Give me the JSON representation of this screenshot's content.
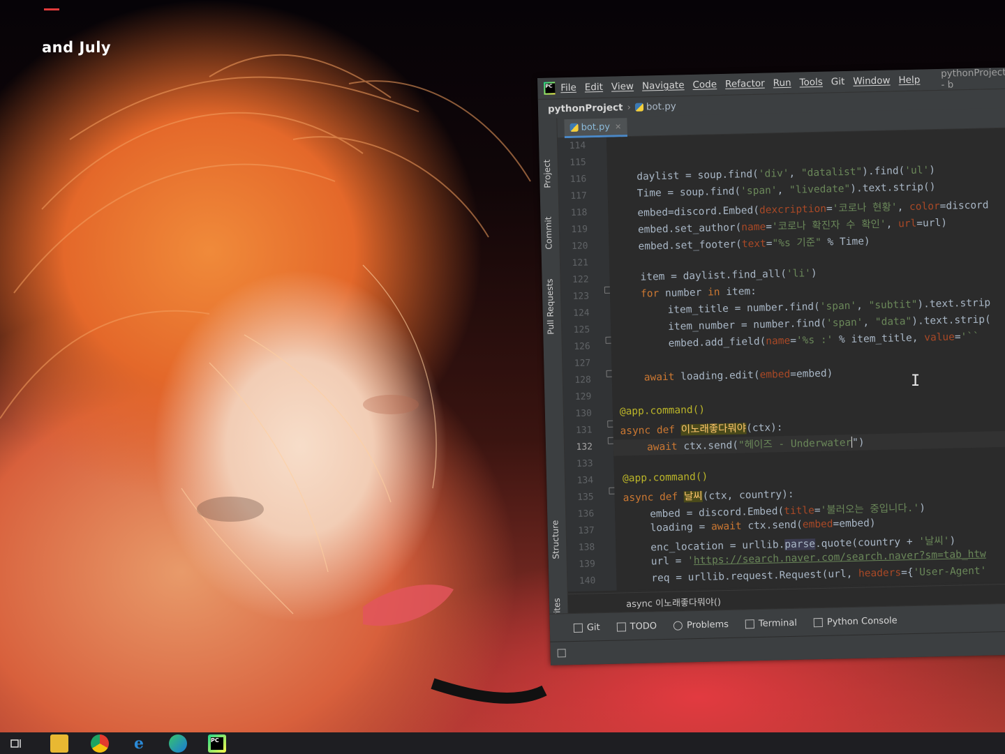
{
  "wallpaper": {
    "caption": "and July"
  },
  "ide": {
    "menu": [
      "File",
      "Edit",
      "View",
      "Navigate",
      "Code",
      "Refactor",
      "Run",
      "Tools",
      "Git",
      "Window",
      "Help"
    ],
    "window_title": "pythonProject - b",
    "breadcrumb": {
      "project": "pythonProject",
      "file": "bot.py"
    },
    "tab": {
      "label": "bot.py"
    },
    "side_tabs": [
      "Project",
      "Commit",
      "Pull Requests",
      "Structure",
      "Favorites"
    ],
    "line_numbers": [
      "114",
      "115",
      "116",
      "117",
      "118",
      "119",
      "120",
      "121",
      "122",
      "123",
      "124",
      "125",
      "126",
      "127",
      "128",
      "129",
      "130",
      "131",
      "132",
      "133",
      "134",
      "135",
      "136",
      "137",
      "138",
      "139",
      "140"
    ],
    "current_line": "132",
    "code": {
      "l116": [
        "daylist = soup.find(",
        "'div'",
        ", ",
        "\"datalist\"",
        ").find(",
        "'ul'",
        ")"
      ],
      "l117": [
        "Time = soup.find(",
        "'span'",
        ", ",
        "\"livedate\"",
        ").text.strip()"
      ],
      "l118": [
        "embed=discord.Embed(",
        "dexcription",
        "=",
        "'코로나 현황'",
        ", ",
        "color",
        "=discord"
      ],
      "l119": [
        "embed.set_author(",
        "name",
        "=",
        "'코로나 확진자 수 확인'",
        ", ",
        "url",
        "=url)"
      ],
      "l120": [
        "embed.set_footer(",
        "text",
        "=",
        "\"%s 기준\"",
        " % Time)"
      ],
      "l122": [
        "item = daylist.find_all(",
        "'li'",
        ")"
      ],
      "l123": [
        "for",
        " number ",
        "in",
        " item:"
      ],
      "l124": [
        "item_title = number.find(",
        "'span'",
        ", ",
        "\"subtit\"",
        ").text.strip"
      ],
      "l125": [
        "item_number = number.find(",
        "'span'",
        ", ",
        "\"data\"",
        ").text.strip("
      ],
      "l126": [
        "embed.add_field(",
        "name",
        "=",
        "'%s :'",
        " % item_title, ",
        "value",
        "=",
        "'``"
      ],
      "l128": [
        "await",
        " loading.edit(",
        "embed",
        "=embed)"
      ],
      "l130": [
        "@app.command()"
      ],
      "l131": [
        "async def",
        " ",
        "이노래좋다뭐야",
        "(ctx)",
        ":"
      ],
      "l132": [
        "await",
        " ctx.send(",
        "\"헤이즈 - Underwater",
        "\")"
      ],
      "l134": [
        "@app.command()"
      ],
      "l135": [
        "async def",
        " ",
        "날씨",
        "(ctx, country)",
        ":"
      ],
      "l136": [
        "embed = discord.Embed(",
        "title",
        "=",
        "'불러오는 중입니다.'",
        ")"
      ],
      "l137": [
        "loading = ",
        "await",
        " ctx.send(",
        "embed",
        "=embed)"
      ],
      "l138": [
        "enc_location = urllib.",
        "parse",
        ".quote(country + ",
        "'날씨'",
        ")"
      ],
      "l139": [
        "url = ",
        "'",
        "https://search.naver.com/search.naver?sm=tab_htw"
      ],
      "l140": [
        "req = urllib.request.Request(url, ",
        "headers",
        "={",
        "'User-Agent'"
      ]
    },
    "context_breadcrumb": "async 이노래좋다뭐야()",
    "tool_windows": [
      "Git",
      "TODO",
      "Problems",
      "Terminal",
      "Python Console"
    ]
  },
  "taskbar": {
    "icons": [
      "task-view-icon",
      "file-explorer-icon",
      "chrome-icon",
      "internet-explorer-icon",
      "edge-icon",
      "pycharm-icon"
    ]
  },
  "colors": {
    "keyword": "#cc7832",
    "string": "#6a8759",
    "param": "#aa4926",
    "decorator": "#bbb529",
    "function": "#ffc66d",
    "editor_bg": "#2b2b2b"
  }
}
